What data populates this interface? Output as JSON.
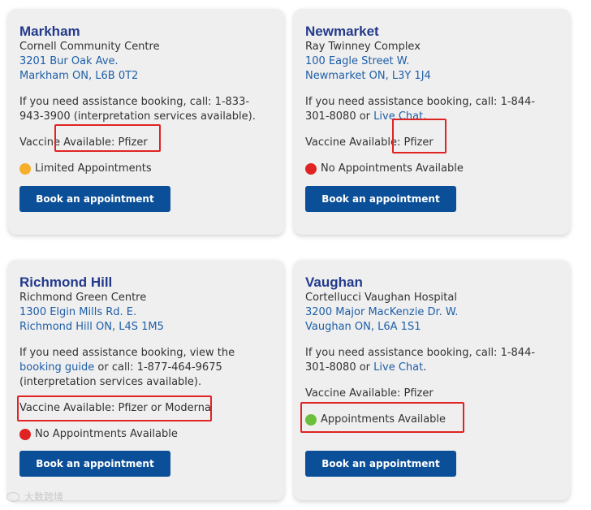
{
  "colors": {
    "title": "#233a8c",
    "link": "#1f5fa8",
    "button": "#0b4f98",
    "highlight": "#e02323",
    "card_bg": "#efefef"
  },
  "button_label": "Book an appointment",
  "cards": [
    {
      "city": "Markham",
      "facility": "Cornell Community Centre",
      "address1": "3201 Bur Oak Ave.",
      "address2": "Markham ON, L6B 0T2",
      "assist_pre": "If you need assistance booking, call: 1-833-943-3900 (interpretation services available).",
      "vaccine": "Vaccine Available: Pfizer",
      "status": "Limited Appointments",
      "status_color": "#f6ae2d"
    },
    {
      "city": "Newmarket",
      "facility": "Ray Twinney Complex",
      "address1": "100 Eagle Street W.",
      "address2": "Newmarket ON, L3Y 1J4",
      "assist_pre": "If you need assistance booking, call: 1-844-301-8080 or ",
      "assist_link": "Live Chat",
      "assist_post": ".",
      "vaccine": "Vaccine Available: Pfizer",
      "status": "No Appointments Available",
      "status_color": "#e02323"
    },
    {
      "city": "Richmond Hill",
      "facility": "Richmond Green Centre",
      "address1": "1300 Elgin Mills Rd. E.",
      "address2": "Richmond Hill ON, L4S 1M5",
      "assist_pre": "If you need assistance booking, view the ",
      "assist_link": "booking guide",
      "assist_post": " or call: 1-877-464-9675 (interpretation services available).",
      "vaccine": "Vaccine Available: Pfizer or Moderna",
      "status": "No Appointments Available",
      "status_color": "#e02323"
    },
    {
      "city": "Vaughan",
      "facility": "Cortellucci Vaughan Hospital",
      "address1": "3200 Major MacKenzie Dr. W.",
      "address2": "Vaughan ON, L6A 1S1",
      "assist_pre": "If you need assistance booking, call: 1-844-301-8080 or ",
      "assist_link": "Live Chat",
      "assist_post": ".",
      "vaccine": "Vaccine Available: Pfizer",
      "status": "Appointments Available",
      "status_color": "#6cbf3c"
    }
  ],
  "watermark": "大数跨境"
}
